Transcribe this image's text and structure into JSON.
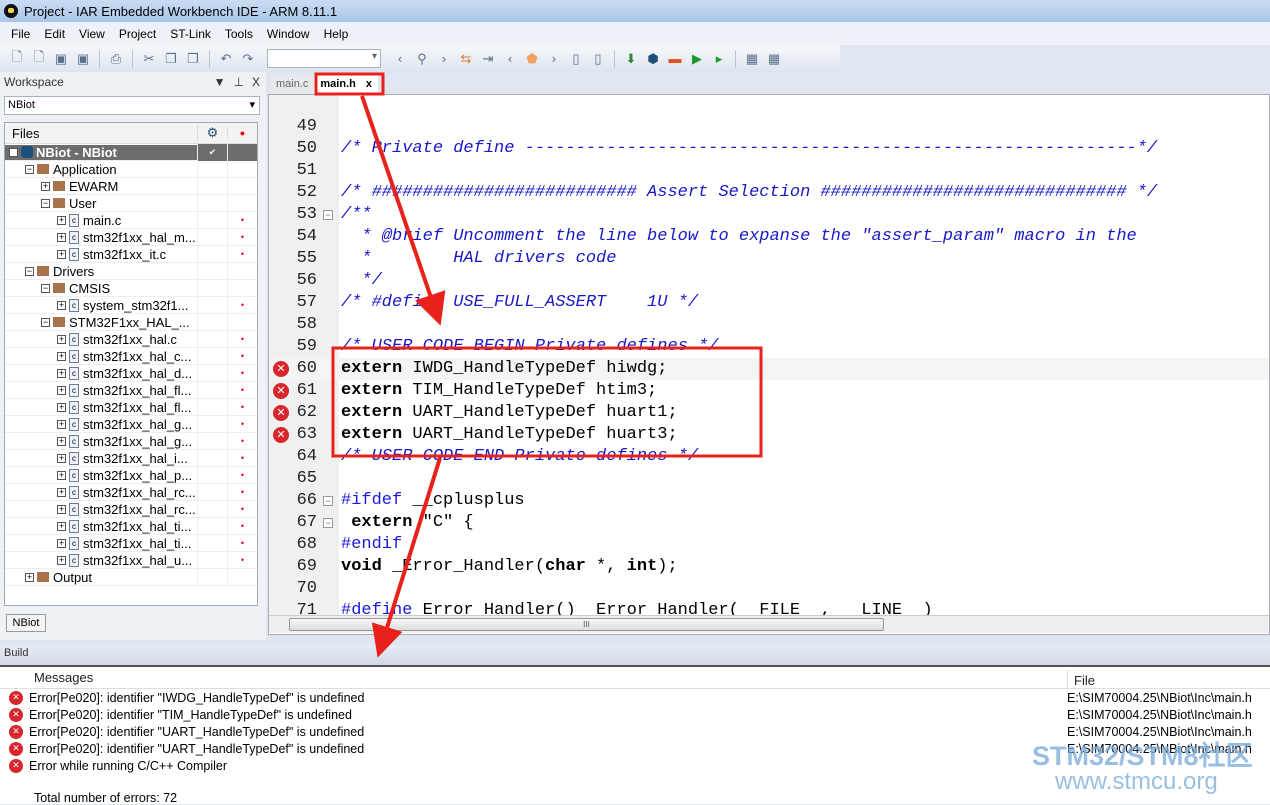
{
  "window": {
    "title": "Project - IAR Embedded Workbench IDE - ARM 8.11.1"
  },
  "menu": [
    "File",
    "Edit",
    "View",
    "Project",
    "ST-Link",
    "Tools",
    "Window",
    "Help"
  ],
  "workspace": {
    "title": "Workspace",
    "controls": [
      "▼",
      "⊥",
      "X"
    ],
    "selected": "NBiot",
    "files_header": "Files",
    "tree": [
      {
        "name": "NBiot - NBiot",
        "depth": 0,
        "type": "project",
        "exp": "-",
        "sel": true,
        "mark": "✔"
      },
      {
        "name": "Application",
        "depth": 1,
        "type": "folder",
        "exp": "-"
      },
      {
        "name": "EWARM",
        "depth": 2,
        "type": "folder",
        "exp": "+"
      },
      {
        "name": "User",
        "depth": 2,
        "type": "folder",
        "exp": "-"
      },
      {
        "name": "main.c",
        "depth": 3,
        "type": "file",
        "exp": "+",
        "dot": true
      },
      {
        "name": "stm32f1xx_hal_m...",
        "depth": 3,
        "type": "file",
        "exp": "+",
        "dot": true
      },
      {
        "name": "stm32f1xx_it.c",
        "depth": 3,
        "type": "file",
        "exp": "+",
        "dot": true
      },
      {
        "name": "Drivers",
        "depth": 1,
        "type": "folder",
        "exp": "-"
      },
      {
        "name": "CMSIS",
        "depth": 2,
        "type": "folder",
        "exp": "-"
      },
      {
        "name": "system_stm32f1...",
        "depth": 3,
        "type": "file",
        "exp": "+",
        "dot": true
      },
      {
        "name": "STM32F1xx_HAL_...",
        "depth": 2,
        "type": "folder",
        "exp": "-"
      },
      {
        "name": "stm32f1xx_hal.c",
        "depth": 3,
        "type": "file",
        "exp": "+",
        "dot": true
      },
      {
        "name": "stm32f1xx_hal_c...",
        "depth": 3,
        "type": "file",
        "exp": "+",
        "dot": true
      },
      {
        "name": "stm32f1xx_hal_d...",
        "depth": 3,
        "type": "file",
        "exp": "+",
        "dot": true
      },
      {
        "name": "stm32f1xx_hal_fl...",
        "depth": 3,
        "type": "file",
        "exp": "+",
        "dot": true
      },
      {
        "name": "stm32f1xx_hal_fl...",
        "depth": 3,
        "type": "file",
        "exp": "+",
        "dot": true
      },
      {
        "name": "stm32f1xx_hal_g...",
        "depth": 3,
        "type": "file",
        "exp": "+",
        "dot": true
      },
      {
        "name": "stm32f1xx_hal_g...",
        "depth": 3,
        "type": "file",
        "exp": "+",
        "dot": true
      },
      {
        "name": "stm32f1xx_hal_i...",
        "depth": 3,
        "type": "file",
        "exp": "+",
        "dot": true
      },
      {
        "name": "stm32f1xx_hal_p...",
        "depth": 3,
        "type": "file",
        "exp": "+",
        "dot": true
      },
      {
        "name": "stm32f1xx_hal_rc...",
        "depth": 3,
        "type": "file",
        "exp": "+",
        "dot": true
      },
      {
        "name": "stm32f1xx_hal_rc...",
        "depth": 3,
        "type": "file",
        "exp": "+",
        "dot": true
      },
      {
        "name": "stm32f1xx_hal_ti...",
        "depth": 3,
        "type": "file",
        "exp": "+",
        "dot": true
      },
      {
        "name": "stm32f1xx_hal_ti...",
        "depth": 3,
        "type": "file",
        "exp": "+",
        "dot": true
      },
      {
        "name": "stm32f1xx_hal_u...",
        "depth": 3,
        "type": "file",
        "exp": "+",
        "dot": true
      },
      {
        "name": "Output",
        "depth": 1,
        "type": "folder",
        "exp": "+"
      }
    ],
    "bottom_tab": "NBiot"
  },
  "editor": {
    "tabs": [
      {
        "label": "main.c",
        "active": false
      },
      {
        "label": "main.h",
        "active": true,
        "close": "x"
      }
    ],
    "lines": [
      {
        "n": "49",
        "t": []
      },
      {
        "n": "50",
        "t": [
          [
            "cm",
            "/* Private define ------------------------------------------------------------*/"
          ]
        ]
      },
      {
        "n": "51",
        "t": []
      },
      {
        "n": "52",
        "t": [
          [
            "cm",
            "/* ########################## Assert Selection ############################## */"
          ]
        ]
      },
      {
        "n": "53",
        "fold": true,
        "t": [
          [
            "cm",
            "/**"
          ]
        ]
      },
      {
        "n": "54",
        "t": [
          [
            "cm",
            "  * @brief Uncomment the line below to expanse the \"assert_param\" macro in the"
          ]
        ]
      },
      {
        "n": "55",
        "t": [
          [
            "cm",
            "  *        HAL drivers code"
          ]
        ]
      },
      {
        "n": "56",
        "t": [
          [
            "cm",
            "  */"
          ]
        ]
      },
      {
        "n": "57",
        "t": [
          [
            "cm",
            "/* #define USE_FULL_ASSERT    1U */"
          ]
        ]
      },
      {
        "n": "58",
        "t": []
      },
      {
        "n": "59",
        "t": [
          [
            "cm",
            "/* USER CODE BEGIN Private defines */"
          ]
        ]
      },
      {
        "n": "60",
        "err": true,
        "hl": true,
        "t": [
          [
            "kw",
            "extern"
          ],
          [
            "tx",
            " IWDG_HandleTypeDef hiwdg;"
          ]
        ]
      },
      {
        "n": "61",
        "err": true,
        "t": [
          [
            "kw",
            "extern"
          ],
          [
            "tx",
            " TIM_HandleTypeDef htim3;"
          ]
        ]
      },
      {
        "n": "62",
        "err": true,
        "t": [
          [
            "kw",
            "extern"
          ],
          [
            "tx",
            " UART_HandleTypeDef huart1;"
          ]
        ]
      },
      {
        "n": "63",
        "err": true,
        "t": [
          [
            "kw",
            "extern"
          ],
          [
            "tx",
            " UART_HandleTypeDef huart3;"
          ]
        ]
      },
      {
        "n": "64",
        "t": [
          [
            "cm",
            "/* USER CODE END Private defines */"
          ]
        ]
      },
      {
        "n": "65",
        "t": []
      },
      {
        "n": "66",
        "fold": true,
        "t": [
          [
            "pp",
            "#ifdef"
          ],
          [
            "tx",
            " __cplusplus"
          ]
        ]
      },
      {
        "n": "67",
        "fold": true,
        "t": [
          [
            "tx",
            " "
          ],
          [
            "kw",
            "extern"
          ],
          [
            "tx",
            " \"C\" {"
          ]
        ]
      },
      {
        "n": "68",
        "t": [
          [
            "pp",
            "#endif"
          ]
        ]
      },
      {
        "n": "69",
        "t": [
          [
            "kw",
            "void"
          ],
          [
            "tx",
            " _Error_Handler("
          ],
          [
            "kw",
            "char"
          ],
          [
            "tx",
            " *, "
          ],
          [
            "kw",
            "int"
          ],
          [
            "tx",
            ");"
          ]
        ]
      },
      {
        "n": "70",
        "t": []
      },
      {
        "n": "71",
        "t": [
          [
            "pp",
            "#define"
          ],
          [
            "tx",
            " Error_Handler() _Error_Handler(__FILE__, __LINE__)"
          ]
        ]
      }
    ]
  },
  "build": {
    "title": "Build",
    "columns": [
      "Messages",
      "File"
    ],
    "messages": [
      {
        "text": "Error[Pe020]: identifier \"IWDG_HandleTypeDef\" is undefined",
        "file": "E:\\SIM70004.25\\NBiot\\Inc\\main.h"
      },
      {
        "text": "Error[Pe020]: identifier \"TIM_HandleTypeDef\" is undefined",
        "file": "E:\\SIM70004.25\\NBiot\\Inc\\main.h"
      },
      {
        "text": "Error[Pe020]: identifier \"UART_HandleTypeDef\" is undefined",
        "file": "E:\\SIM70004.25\\NBiot\\Inc\\main.h"
      },
      {
        "text": "Error[Pe020]: identifier \"UART_HandleTypeDef\" is undefined",
        "file": "E:\\SIM70004.25\\NBiot\\Inc\\main.h"
      },
      {
        "text": "Error while running C/C++ Compiler",
        "file": ""
      }
    ],
    "total": "Total number of errors: 72"
  },
  "watermark": {
    "line1": "STM32/STM8社区",
    "line2": "www.stmcu.org"
  },
  "colors": {
    "annotation": "#e8211b",
    "error": "#d9262d",
    "comment": "#1919c8"
  }
}
